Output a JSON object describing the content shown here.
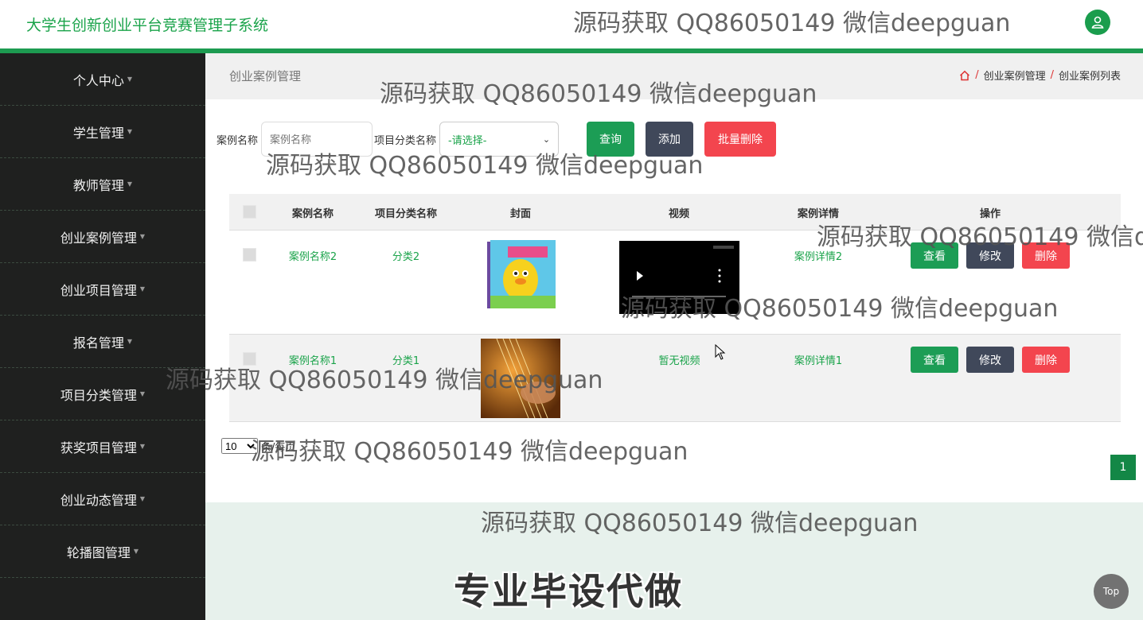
{
  "app": {
    "title": "大学生创新创业平台竞赛管理子系统"
  },
  "sidebar": {
    "items": [
      {
        "label": "个人中心"
      },
      {
        "label": "学生管理"
      },
      {
        "label": "教师管理"
      },
      {
        "label": "创业案例管理"
      },
      {
        "label": "创业项目管理"
      },
      {
        "label": "报名管理"
      },
      {
        "label": "项目分类管理"
      },
      {
        "label": "获奖项目管理"
      },
      {
        "label": "创业动态管理"
      },
      {
        "label": "轮播图管理"
      }
    ]
  },
  "page": {
    "title": "创业案例管理",
    "breadcrumb": [
      "创业案例管理",
      "创业案例列表"
    ]
  },
  "filters": {
    "case_name_label": "案例名称",
    "case_name_placeholder": "案例名称",
    "category_label": "项目分类名称",
    "category_selected": "-请选择-",
    "search_btn": "查询",
    "add_btn": "添加",
    "batch_delete_btn": "批量删除"
  },
  "table": {
    "columns": [
      "案例名称",
      "项目分类名称",
      "封面",
      "视频",
      "案例详情",
      "操作"
    ],
    "rows": [
      {
        "name": "案例名称2",
        "category": "分类2",
        "video": "",
        "detail": "案例详情2"
      },
      {
        "name": "案例名称1",
        "category": "分类1",
        "video": "暂无视频",
        "detail": "案例详情1"
      }
    ],
    "actions": {
      "view": "查看",
      "edit": "修改",
      "delete": "删除"
    }
  },
  "pagination": {
    "page_size": "10",
    "page_size_suffix": "条/每页",
    "current_page": "1"
  },
  "banner": "专业毕设代做",
  "top_button": "Top",
  "watermark": "源码获取 QQ86050149 微信deepguan",
  "colors": {
    "accent": "#1aa34a",
    "sidebar_bg": "#1f201f",
    "danger": "#f3454e",
    "dark_btn": "#40485a"
  }
}
